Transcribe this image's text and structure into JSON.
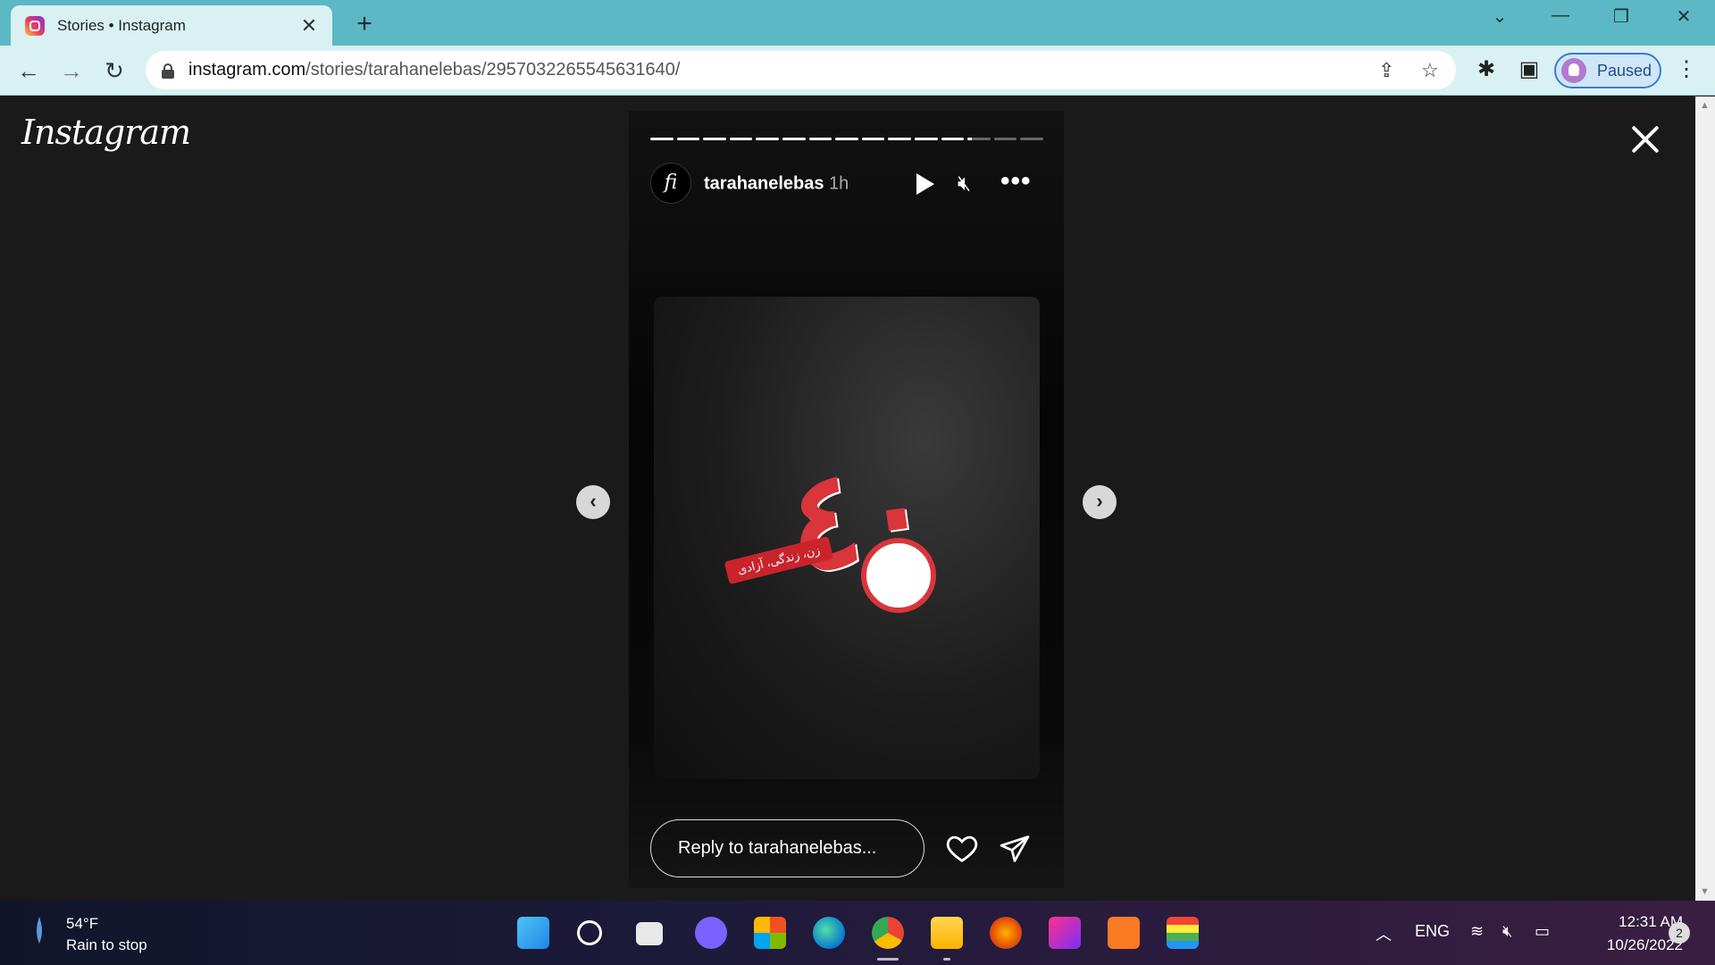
{
  "browser": {
    "tab_title": "Stories • Instagram",
    "url_host": "instagram.com",
    "url_path": "/stories/tarahanelebas/2957032265545631640/",
    "profile_label": "Paused"
  },
  "page": {
    "logo": "Instagram",
    "story": {
      "avatar_text": "fi",
      "username": "tarahanelebas",
      "time": "1h",
      "reply_placeholder": "Reply to tarahanelebas...",
      "ribbon_text": "زن، زندگی، آزادی",
      "progress_segments": 15,
      "current_segment": 13
    }
  },
  "taskbar": {
    "weather_temp": "54°F",
    "weather_desc": "Rain to stop",
    "language": "ENG",
    "time": "12:31 AM",
    "date": "10/26/2022",
    "notification_count": "2"
  },
  "colors": {
    "tabbar": "#5bb8c4",
    "toolbar": "#d9f1f3",
    "page_bg": "#1a1a1a",
    "emblem_red": "#d9353b"
  }
}
